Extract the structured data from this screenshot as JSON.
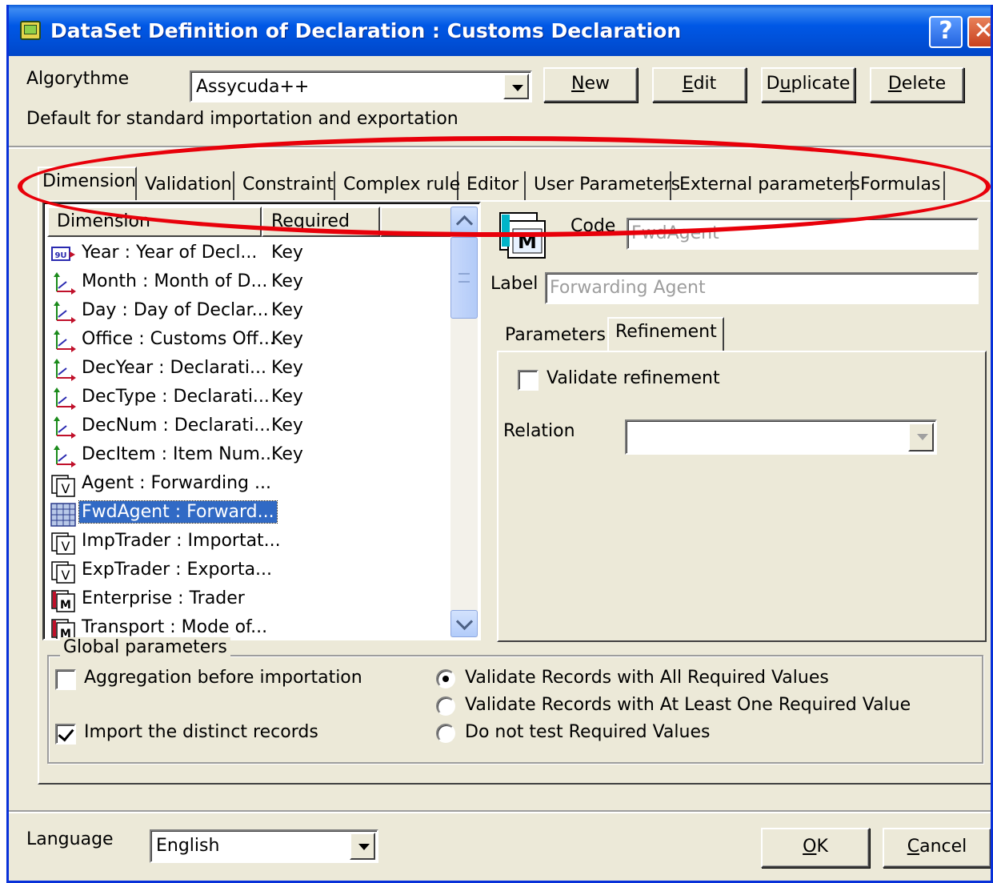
{
  "window": {
    "title": "DataSet Definition of Declaration : Customs Declaration",
    "help_glyph": "?",
    "close_glyph": "✕"
  },
  "algorithm": {
    "label": "Algorythme",
    "selected": "Assycuda++",
    "description": "Default for standard importation and exportation"
  },
  "toolbar": {
    "new_pre": "",
    "new_acc": "N",
    "new_post": "ew",
    "edit_pre": "",
    "edit_acc": "E",
    "edit_post": "dit",
    "dup_pre": "D",
    "dup_acc": "u",
    "dup_post": "plicate",
    "del_pre": "",
    "del_acc": "D",
    "del_post": "elete"
  },
  "tabs": [
    {
      "label": "Dimension"
    },
    {
      "label": "Validation"
    },
    {
      "label": "Constraint"
    },
    {
      "label": "Complex rule"
    },
    {
      "label": "Editor"
    },
    {
      "label": "User Parameters"
    },
    {
      "label": "External parameters"
    },
    {
      "label": "Formulas"
    }
  ],
  "list": {
    "col_dimension": "Dimension",
    "col_required": "Required",
    "rows": [
      {
        "name": "Year : Year of Decl...",
        "required": "Key",
        "icon": "calendar-key-icon"
      },
      {
        "name": "Month : Month of D...",
        "required": "Key",
        "icon": "axis-key-icon"
      },
      {
        "name": "Day : Day of Declar...",
        "required": "Key",
        "icon": "axis-key-icon"
      },
      {
        "name": "Office : Customs Off...",
        "required": "Key",
        "icon": "axis-key-icon"
      },
      {
        "name": "DecYear : Declarati...",
        "required": "Key",
        "icon": "axis-key-icon"
      },
      {
        "name": "DecType : Declarati...",
        "required": "Key",
        "icon": "axis-key-icon"
      },
      {
        "name": "DecNum : Declarati...",
        "required": "Key",
        "icon": "axis-key-icon"
      },
      {
        "name": "DecItem : Item Num...",
        "required": "Key",
        "icon": "axis-key-icon"
      },
      {
        "name": "Agent : Forwarding ...",
        "required": "",
        "icon": "validated-dimension-icon"
      },
      {
        "name": "FwdAgent : Forward...",
        "required": "",
        "icon": "grid-dimension-icon"
      },
      {
        "name": "ImpTrader : Importat...",
        "required": "",
        "icon": "validated-dimension-icon"
      },
      {
        "name": "ExpTrader : Exporta...",
        "required": "",
        "icon": "validated-dimension-icon"
      },
      {
        "name": "Enterprise : Trader",
        "required": "",
        "icon": "measure-dimension-icon"
      },
      {
        "name": "Transport : Mode of...",
        "required": "",
        "icon": "measure-dimension-icon"
      }
    ]
  },
  "detail": {
    "code_label": "Code",
    "code_value": "FwdAgent",
    "label_label": "Label",
    "label_value": "Forwarding Agent",
    "icon_letter": "M",
    "subtabs": [
      {
        "label": "Parameters"
      },
      {
        "label": "Refinement"
      }
    ],
    "validate_refinement": "Validate refinement",
    "relation_label": "Relation",
    "relation_value": ""
  },
  "global": {
    "title": "Global parameters",
    "aggregation": "Aggregation before importation",
    "import_distinct": "Import the distinct records",
    "radio_all": "Validate Records with All Required Values",
    "radio_one": "Validate Records with At Least One Required Value",
    "radio_none": "Do not test Required Values"
  },
  "footer": {
    "language_label": "Language",
    "language_value": "English",
    "ok_pre": "",
    "ok_acc": "O",
    "ok_post": "K",
    "cancel_pre": "",
    "cancel_acc": "C",
    "cancel_post": "ancel"
  },
  "colors": {
    "titlebar": "#0054e3",
    "selection": "#316ac5",
    "annotation": "#e8000a",
    "face": "#ece9d8"
  }
}
